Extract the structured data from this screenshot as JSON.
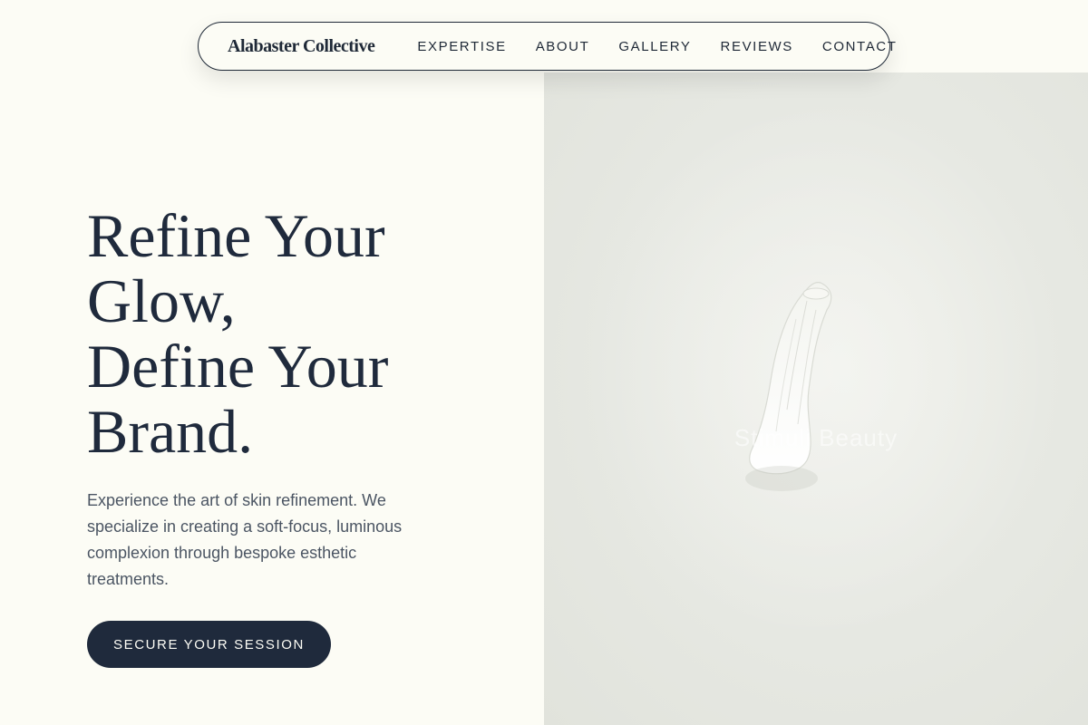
{
  "nav": {
    "brand": "Alabaster Collective",
    "links": [
      {
        "label": "EXPERTISE"
      },
      {
        "label": "ABOUT"
      },
      {
        "label": "GALLERY"
      },
      {
        "label": "REVIEWS"
      },
      {
        "label": "CONTACT"
      }
    ]
  },
  "hero": {
    "title_lines": [
      "Refine Your",
      "Glow,",
      "Define Your",
      "Brand."
    ],
    "description": "Experience the art of skin refinement. We specialize in creating a soft-focus, luminous complexion through bespoke esthetic treatments.",
    "cta_label": "SECURE YOUR SESSION"
  },
  "image": {
    "watermark": "Stimuli Beauty"
  },
  "colors": {
    "background": "#fcfcf5",
    "navy": "#1f2a3c",
    "text_muted": "#4b5563",
    "image_bg": "#e6e8e2"
  }
}
